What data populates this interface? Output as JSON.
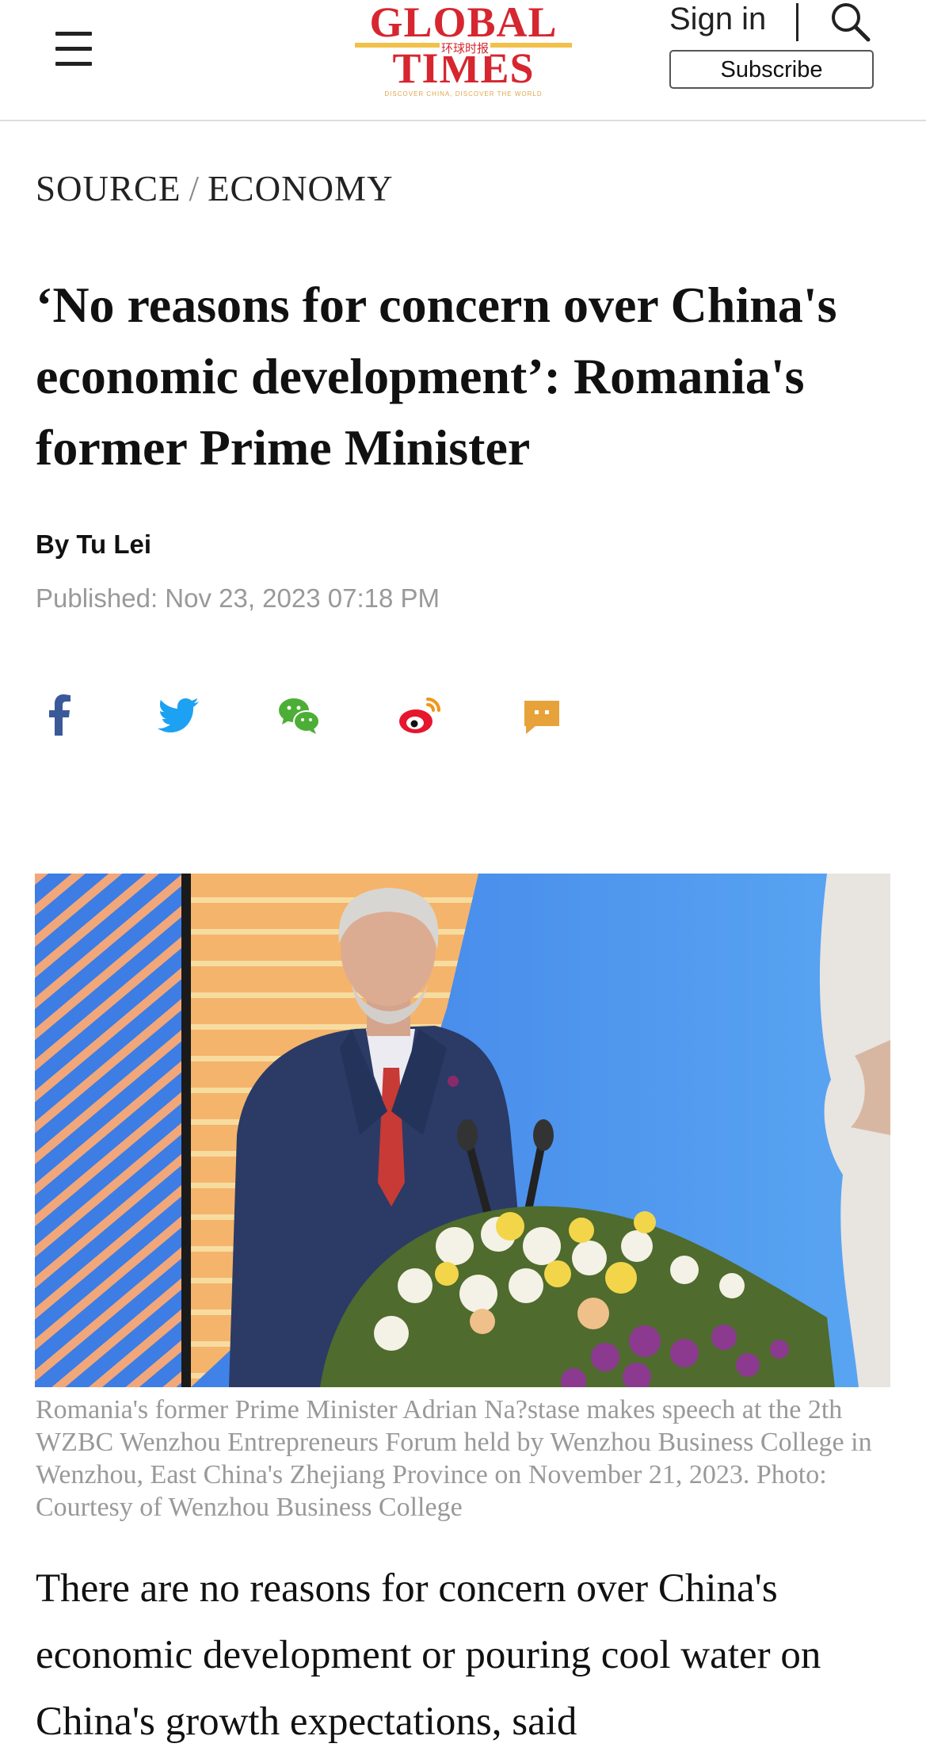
{
  "header": {
    "logo_line1": "GLOBAL",
    "logo_line2": "TIMES",
    "logo_chinese": "环球时报",
    "logo_tagline": "DISCOVER CHINA, DISCOVER THE WORLD",
    "sign_in": "Sign in",
    "subscribe": "Subscribe",
    "menu_icon": "hamburger-menu-icon",
    "search_icon": "search-icon"
  },
  "breadcrumb": {
    "section": "SOURCE",
    "separator": "/",
    "subsection": "ECONOMY"
  },
  "article": {
    "headline": "‘No reasons for concern over China's economic development’: Romania's former Prime Minister",
    "byline": "By Tu Lei",
    "published": "Published: Nov 23, 2023 07:18 PM",
    "caption": "Romania's former Prime Minister Adrian Na?stase makes speech at the 2th WZBC Wenzhou Entrepreneurs Forum held by Wenzhou Business College in Wenzhou, East China's Zhejiang Province on November 21, 2023. Photo: Courtesy of Wenzhou Business College",
    "body_start": "There are no reasons for concern over China's economic development or pouring cool water on China's growth expectations, said"
  },
  "share": [
    {
      "icon": "facebook-icon",
      "color": "#3b5998"
    },
    {
      "icon": "twitter-icon",
      "color": "#1da1f2"
    },
    {
      "icon": "wechat-icon",
      "color": "#4cae36"
    },
    {
      "icon": "weibo-icon",
      "color": "#e6162d"
    },
    {
      "icon": "comment-icon",
      "color": "#e8a23a"
    }
  ],
  "colors": {
    "brand_red": "#d6262f",
    "brand_gold": "#f2c14a",
    "muted_text": "#999999"
  }
}
